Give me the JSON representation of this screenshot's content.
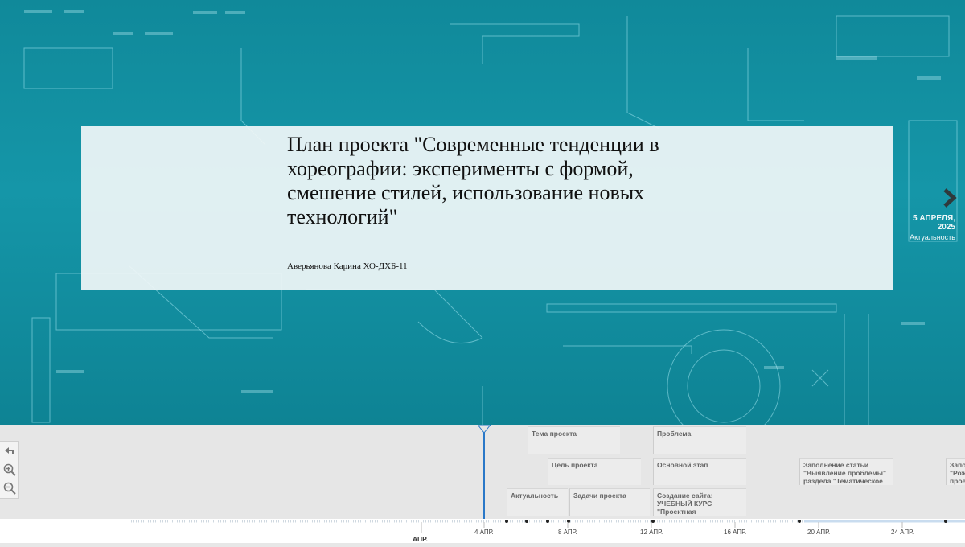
{
  "slide": {
    "title": "План проекта \"Современные тенденции в хореографии: эксперименты с формой, смешение стилей, использование новых технологий\"",
    "author": "Аверьянова Карина ХО-ДХБ-11"
  },
  "next": {
    "date": "5 АПРЕЛЯ, 2025",
    "label": "Актуальность",
    "icon": "chevron-right-icon"
  },
  "tools": [
    "back-icon",
    "zoom-in-icon",
    "zoom-out-icon"
  ],
  "events": [
    {
      "label": "Тема проекта"
    },
    {
      "label": "Цель проекта"
    },
    {
      "label": "Актуальность"
    },
    {
      "label": "Задачи проекта"
    },
    {
      "label": "Проблема"
    },
    {
      "label": "Основной этап"
    },
    {
      "label": "Создание сайта: УЧЕБНЫЙ КУРС \"Проектная"
    },
    {
      "label": "Заполнение статьи \"Выявление проблемы\" раздела \"Тематическое"
    },
    {
      "label": "Запо \"Рож прое"
    }
  ],
  "ruler": {
    "month": "АПР.",
    "ticks": [
      "4 АПР.",
      "8 АПР.",
      "12 АПР.",
      "16 АПР.",
      "20 АПР.",
      "24 АПР."
    ]
  },
  "colors": {
    "accent": "#2a78c8",
    "stage": "#1596a8"
  }
}
